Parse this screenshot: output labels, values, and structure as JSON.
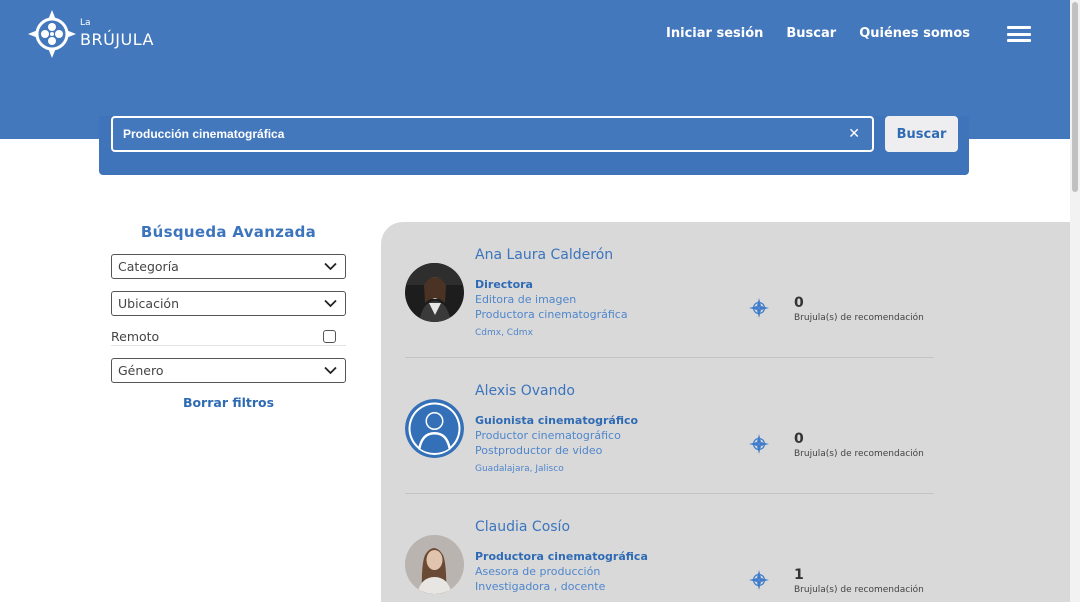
{
  "header": {
    "logo": {
      "prefix": "La",
      "name": "BRÚJULA",
      "icon": "compass-film-reel-icon"
    },
    "nav": [
      {
        "label": "Iniciar sesión"
      },
      {
        "label": "Buscar"
      },
      {
        "label": "Quiénes somos"
      }
    ],
    "menu_icon": "hamburger-icon",
    "colors": {
      "primary": "#4478bd",
      "text_light": "#ffffff"
    }
  },
  "search": {
    "value": "Producción cinematográfica",
    "clear_icon": "close-icon",
    "button_label": "Buscar"
  },
  "filters": {
    "title": "Búsqueda Avanzada",
    "selects": [
      {
        "label": "Categoría"
      },
      {
        "label": "Ubicación"
      },
      {
        "label": "Género"
      }
    ],
    "remote": {
      "label": "Remoto",
      "checked": false
    },
    "clear_label": "Borrar filtros"
  },
  "results": [
    {
      "name": "Ana Laura Calderón",
      "roles": [
        "Directora",
        "Editora de imagen",
        "Productora cinematográfica"
      ],
      "location": "Cdmx, Cdmx",
      "count": "0",
      "count_label": "Brujula(s) de recomendación",
      "avatar": "photo"
    },
    {
      "name": "Alexis Ovando",
      "roles": [
        "Guionista cinematográfico",
        "Productor cinematográfico",
        "Postproductor de video"
      ],
      "location": "Guadalajara, Jalisco",
      "count": "0",
      "count_label": "Brujula(s) de recomendación",
      "avatar": "default-user-icon"
    },
    {
      "name": "Claudia Cosío",
      "roles": [
        "Productora cinematográfica",
        "Asesora de producción",
        "Investigadora , docente"
      ],
      "location": "",
      "count": "1",
      "count_label": "Brujula(s) de recomendación",
      "avatar": "photo"
    }
  ]
}
